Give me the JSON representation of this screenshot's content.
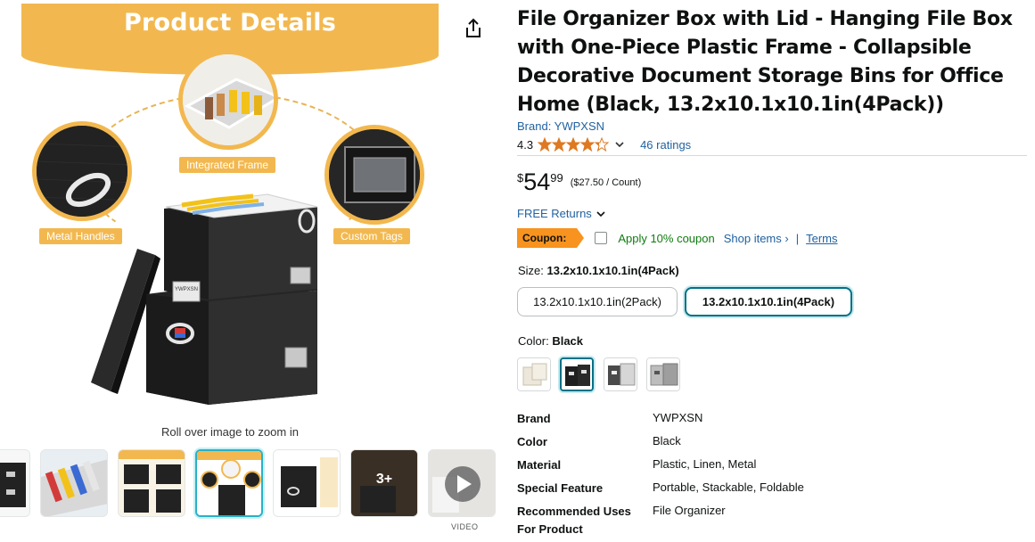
{
  "image": {
    "banner_title": "Product Details",
    "callouts": {
      "frame": "Integrated Frame",
      "handles": "Metal Handles",
      "tags": "Custom Tags"
    },
    "box_label": "YWPXSN",
    "zoom_hint": "Roll over image to zoom in"
  },
  "thumbnails": {
    "more_label": "3+",
    "video_label": "VIDEO"
  },
  "product": {
    "title": "File Organizer Box with Lid - Hanging File Box with One-Piece Plastic Frame - Collapsible Decorative Document Storage Bins for Office Home (Black, 13.2x10.1x10.1in(4Pack))",
    "brand_link": "Brand: YWPXSN",
    "rating": "4.3",
    "rating_value": 4.3,
    "rating_count": "46 ratings",
    "price_currency": "$",
    "price_whole": "54",
    "price_fraction": "99",
    "unit_price": "($27.50 / Count)",
    "returns": "FREE Returns",
    "coupon_badge": "Coupon:",
    "coupon_text": "Apply 10% coupon",
    "shop_items": "Shop items ›",
    "pipe": "|",
    "terms": "Terms"
  },
  "size": {
    "label": "Size:",
    "selected": "13.2x10.1x10.1in(4Pack)",
    "options": [
      "13.2x10.1x10.1in(2Pack)",
      "13.2x10.1x10.1in(4Pack)"
    ]
  },
  "color": {
    "label": "Color:",
    "selected": "Black"
  },
  "specs": [
    {
      "key": "Brand",
      "value": "YWPXSN"
    },
    {
      "key": "Color",
      "value": "Black"
    },
    {
      "key": "Material",
      "value": "Plastic, Linen, Metal"
    },
    {
      "key": "Special Feature",
      "value": "Portable, Stackable, Foldable"
    },
    {
      "key": "Recommended Uses For Product",
      "value": "File Organizer"
    }
  ],
  "colors": {
    "star": "#de7921",
    "link": "#2162a1",
    "coupon": "#f7931e",
    "accent": "#f2b84f",
    "selected_border": "#007185"
  }
}
